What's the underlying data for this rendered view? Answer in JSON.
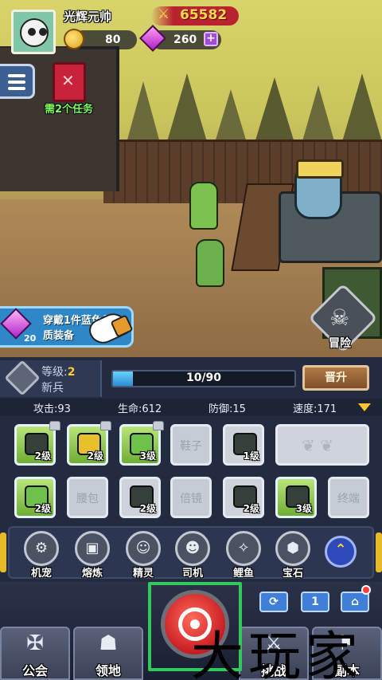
{
  "player": {
    "name": "光辉元帅",
    "power": "65582",
    "coins": "80",
    "gems": "260"
  },
  "hud": {
    "task_label": "需2个任务",
    "quest_count": "20",
    "quest_line1": "穿戴1件蓝色品",
    "quest_line2": "质装备",
    "adventure_label": "冒险"
  },
  "rank": {
    "level_label": "等级:",
    "level_value": "2",
    "title": "新兵",
    "xp_text": "10/90",
    "xp_fraction": 0.111,
    "promote_label": "晋升"
  },
  "stats": {
    "attack": "攻击:93",
    "hp": "生命:612",
    "defense": "防御:15",
    "speed": "速度:171"
  },
  "equipment": {
    "row1": [
      {
        "level": "2级"
      },
      {
        "level": "2级"
      },
      {
        "level": "3级"
      },
      {
        "placeholder": "鞋子"
      },
      {
        "level": "1级"
      }
    ],
    "row2": [
      {
        "level": "2级"
      },
      {
        "placeholder": "腰包"
      },
      {
        "level": "2级"
      },
      {
        "placeholder": "倍镜"
      },
      {
        "level": "2级"
      },
      {
        "level": "3级"
      },
      {
        "placeholder": "终端"
      }
    ]
  },
  "skills": [
    "机宠",
    "熔炼",
    "精灵",
    "司机",
    "鲤鱼",
    "宝石"
  ],
  "utility": {
    "count_label": "1"
  },
  "nav": {
    "guild": "公会",
    "territory": "领地",
    "challenge": "挑战",
    "dungeon": "副本"
  },
  "watermark": "大玩家",
  "colors": {
    "highlight_frame": "#34c759",
    "accent_gold": "#ffc52e",
    "gem_purple": "#b021c8"
  }
}
